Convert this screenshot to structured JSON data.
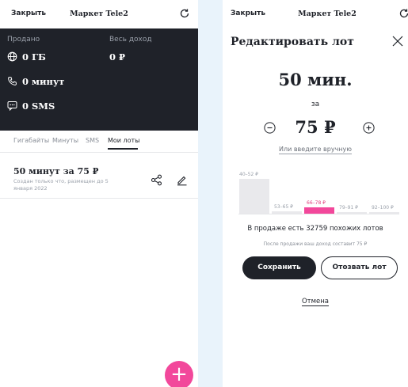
{
  "left": {
    "topbar": {
      "close": "Закрыть",
      "title": "Маркет Tele2"
    },
    "summary": {
      "sold_label": "Продано",
      "income_label": "Весь доход",
      "gb_value": "0 ГБ",
      "income_value": "0 ₽",
      "minutes_value": "0 минут",
      "sms_value": "0 SMS"
    },
    "tabs": [
      "Гигабайты",
      "Минуты",
      "SMS",
      "Мои лоты"
    ],
    "active_tab": "Мои лоты",
    "lot": {
      "title": "50 минут за 75 ₽",
      "subtitle": "Создан только что, размещен до 5 января 2022"
    },
    "fab": "+"
  },
  "right": {
    "topbar": {
      "close": "Закрыть",
      "title": "Маркет Tele2"
    },
    "heading": "Редактировать лот",
    "amount": "50 мин.",
    "for_label": "за",
    "price": "75 ₽",
    "manual_link": "Или введите вручную",
    "chart_data": {
      "type": "bar",
      "categories": [
        "40–52 ₽",
        "53–65 ₽",
        "66–78 ₽",
        "79–91 ₽",
        "92–100 ₽"
      ],
      "values": [
        1.0,
        0.06,
        0.18,
        0.05,
        0.05
      ],
      "highlight_index": 2,
      "colors": {
        "normal": "#e9e9ec",
        "highlight": "#f2489b"
      }
    },
    "similar_count": "В продаже есть 32759 похожих лотов",
    "income_note": "После продажи ваш доход составит 75 ₽",
    "save_button": "Сохранить",
    "withdraw_button": "Отозвать лот",
    "cancel_link": "Отмена"
  }
}
